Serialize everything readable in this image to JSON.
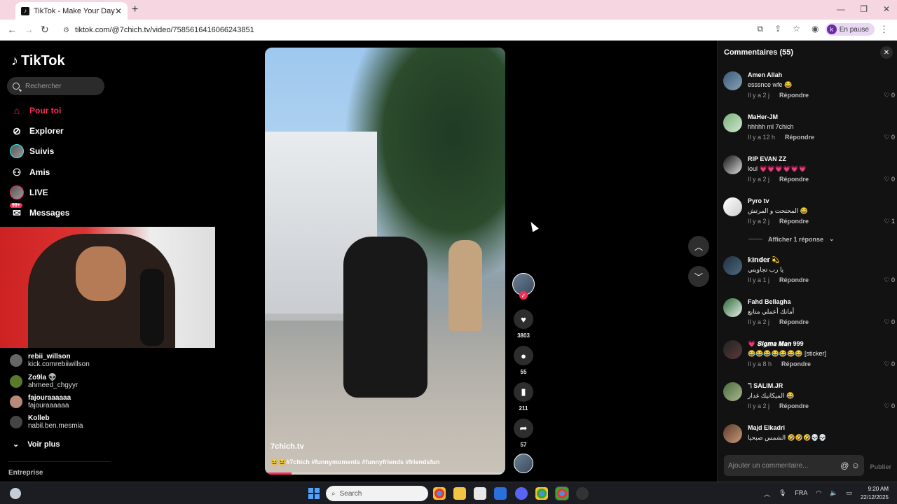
{
  "browser": {
    "tab_title": "TikTok - Make Your Day",
    "url": "tiktok.com/@7chich.tv/video/7585616416066243851",
    "profile_status": "En pause",
    "profile_initial": "k"
  },
  "sidebar": {
    "brand": "TikTok",
    "search_placeholder": "Rechercher",
    "nav": [
      {
        "label": "Pour toi",
        "icon": "home-icon",
        "active": true
      },
      {
        "label": "Explorer",
        "icon": "compass-icon"
      },
      {
        "label": "Suivis",
        "icon": "following-avatar-icon"
      },
      {
        "label": "Amis",
        "icon": "friends-icon"
      },
      {
        "label": "LIVE",
        "icon": "live-avatar-icon"
      },
      {
        "label": "Messages",
        "icon": "messages-icon",
        "badge": "99+"
      }
    ],
    "following": [
      {
        "name": "rebii_willson",
        "handle": "kick.comrebiiwillson"
      },
      {
        "name": "Zo9la 👽",
        "handle": "ahmeed_chgyyr"
      },
      {
        "name": "fajouraaaaaa",
        "handle": "fajouraaaaaa"
      },
      {
        "name": "Kolleb",
        "handle": "nabil.ben.mesmia"
      }
    ],
    "see_more": "Voir plus",
    "company": "Entreprise"
  },
  "video": {
    "author": "7chich.tv",
    "caption": "😆😆#7chich #funnymoments #funnyfriends #friendsfun",
    "progress": 0.11,
    "likes": "3803",
    "comments": "55",
    "saves": "211",
    "shares": "57"
  },
  "comments_panel": {
    "title": "Commentaires (55)",
    "reply_label": "Répondre",
    "show_replies": "Afficher 1 réponse",
    "input_placeholder": "Ajouter un commentaire...",
    "publish_label": "Publier",
    "items": [
      {
        "name": "Amen Allah",
        "text": "esssnce wfe 😂",
        "time": "Il y a 2 j",
        "likes": "0"
      },
      {
        "name": "MaHer-JM",
        "text": "hhhhh ml 7chich",
        "time": "Il y a 12 h",
        "likes": "0"
      },
      {
        "name": "RIP EVAN ZZ",
        "text": "loul 💗💗💗💗💗💗",
        "time": "Il y a 2 j",
        "likes": "0"
      },
      {
        "name": "Pyro tv",
        "text": "المحتحت و المرتش 😂",
        "time": "Il y a 2 j",
        "likes": "1"
      },
      {
        "name": "𝕜𝕚𝕟𝕕𝕖𝕣 💫",
        "text": "يا رب تجاوبني",
        "time": "Il y a 1 j",
        "likes": "0"
      },
      {
        "name": "Fahd Bellagha",
        "text": "أمانك أعملي متابع",
        "time": "Il y a 2 j",
        "likes": "0"
      },
      {
        "name": "💗 𝑺𝒊𝒈𝒎𝒂 𝑴𝒂𝒏 999",
        "text": "😂😂😂😂😂😂😂 [sticker]",
        "time": "Il y a 8 h",
        "likes": "0"
      },
      {
        "name": "ℸ SALIM.JR",
        "text": "الميكانيك غدار 😂",
        "time": "Il y a 2 j",
        "likes": "0"
      },
      {
        "name": "Majd Elkadri",
        "text": "الشمس صبحيا 🤣🤣🤣💀💀",
        "time": "",
        "likes": ""
      }
    ]
  },
  "taskbar": {
    "search_label": "Search",
    "language": "FRA",
    "time": "9:20 AM",
    "date": "22/12/2025"
  }
}
